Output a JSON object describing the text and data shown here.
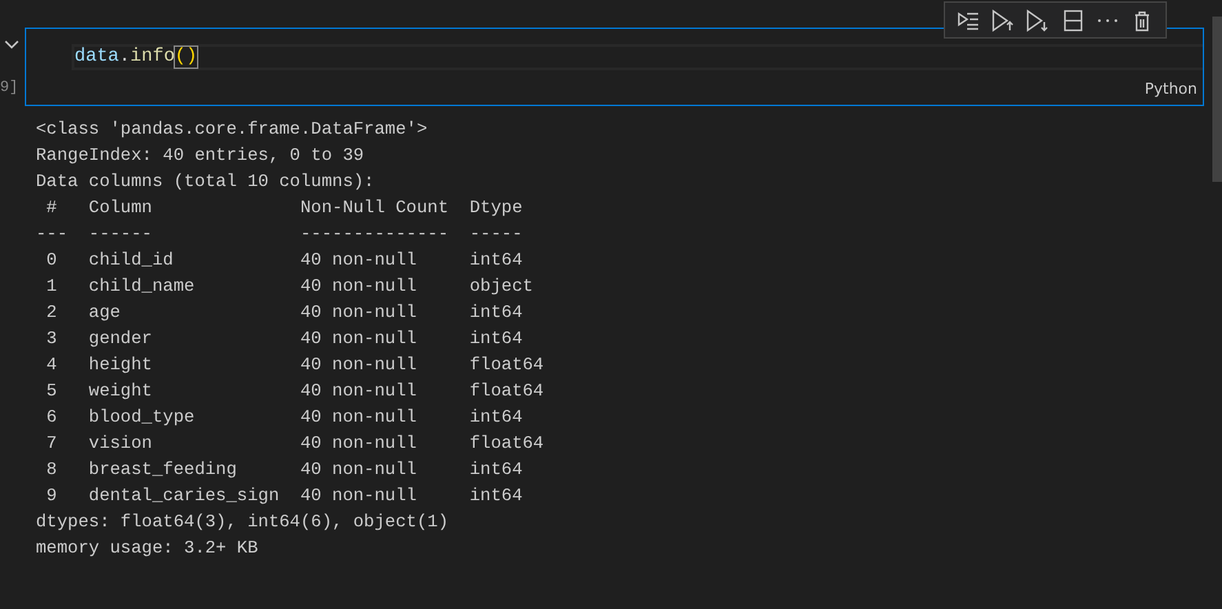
{
  "cell": {
    "execution_count": "9]",
    "expanded": true,
    "language": "Python",
    "code": [
      {
        "text": "data",
        "kind": "variable"
      },
      {
        "text": ".",
        "kind": "plain"
      },
      {
        "text": "info",
        "kind": "function"
      },
      {
        "text": "()",
        "kind": "bracket"
      }
    ],
    "toolbar": [
      {
        "kind": "run-by-line"
      },
      {
        "kind": "run-above"
      },
      {
        "kind": "run-below"
      },
      {
        "kind": "split"
      },
      {
        "kind": "more"
      },
      {
        "kind": "delete"
      }
    ]
  },
  "output": {
    "lines": [
      "<class 'pandas.core.frame.DataFrame'>",
      "RangeIndex: 40 entries, 0 to 39",
      "Data columns (total 10 columns):",
      " #   Column              Non-Null Count  Dtype  ",
      "---  ------              --------------  -----  ",
      " 0   child_id            40 non-null     int64  ",
      " 1   child_name          40 non-null     object ",
      " 2   age                 40 non-null     int64  ",
      " 3   gender              40 non-null     int64  ",
      " 4   height              40 non-null     float64",
      " 5   weight              40 non-null     float64",
      " 6   blood_type          40 non-null     int64  ",
      " 7   vision              40 non-null     float64",
      " 8   breast_feeding      40 non-null     int64  ",
      " 9   dental_caries_sign  40 non-null     int64  ",
      "dtypes: float64(3), int64(6), object(1)",
      "memory usage: 3.2+ KB"
    ]
  }
}
